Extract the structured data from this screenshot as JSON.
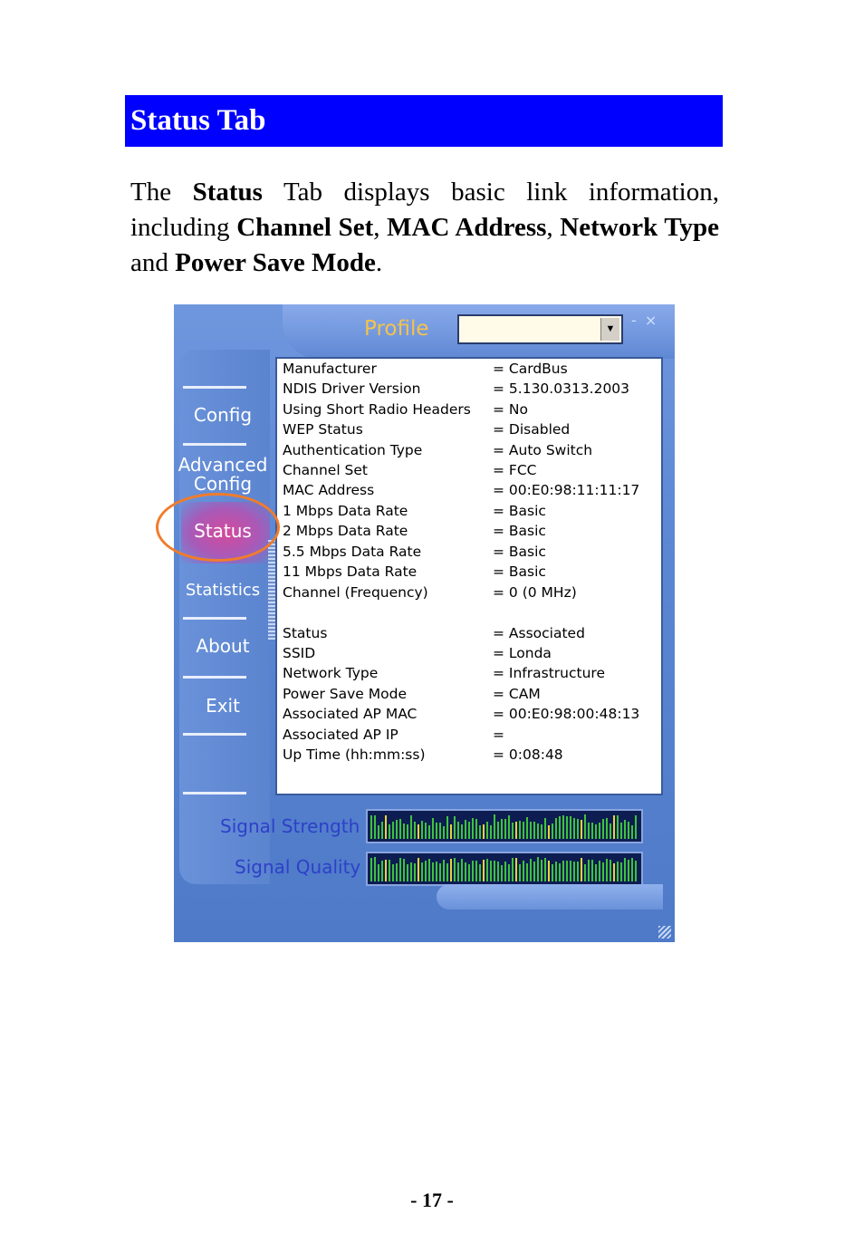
{
  "heading": "Status Tab",
  "intro": {
    "t1": "The ",
    "b1": "Status",
    "t2": " Tab displays basic link information, including ",
    "b2": "Channel Set",
    "t3": ", ",
    "b3": "MAC Address",
    "t4": ", ",
    "b4": "Network Type",
    "t5": " and ",
    "b5": "Power Save Mode",
    "t6": "."
  },
  "app": {
    "profile_label": "Profile",
    "profile_value": "",
    "window_buttons": "- ×",
    "nav": {
      "config": "Config",
      "advanced_1": "Advanced",
      "advanced_2": "Config",
      "status": "Status",
      "statistics": "Statistics",
      "about": "About",
      "exit": "Exit"
    },
    "rows": [
      {
        "label": "Manufacturer",
        "value": "=  CardBus"
      },
      {
        "label": "NDIS Driver Version",
        "value": "=  5.130.0313.2003"
      },
      {
        "label": "Using Short Radio Headers",
        "value": "=  No"
      },
      {
        "label": "WEP Status",
        "value": "=  Disabled"
      },
      {
        "label": "Authentication Type",
        "value": "=  Auto Switch"
      },
      {
        "label": "Channel Set",
        "value": "=  FCC"
      },
      {
        "label": "MAC Address",
        "value": "=  00:E0:98:11:11:17"
      },
      {
        "label": "1 Mbps Data Rate",
        "value": "=  Basic"
      },
      {
        "label": "2 Mbps Data Rate",
        "value": "=  Basic"
      },
      {
        "label": "5.5 Mbps Data Rate",
        "value": "=  Basic"
      },
      {
        "label": "11 Mbps Data Rate",
        "value": "=  Basic"
      },
      {
        "label": "Channel (Frequency)",
        "value": "=  0 (0 MHz)"
      },
      {
        "label": "Status",
        "value": "=  Associated"
      },
      {
        "label": "SSID",
        "value": "=  Londa"
      },
      {
        "label": "Network Type",
        "value": "=  Infrastructure"
      },
      {
        "label": "Power Save Mode",
        "value": "=  CAM"
      },
      {
        "label": "Associated AP MAC",
        "value": "=  00:E0:98:00:48:13"
      },
      {
        "label": "Associated AP IP",
        "value": "="
      },
      {
        "label": "Up Time (hh:mm:ss)",
        "value": "=  0:08:48"
      }
    ],
    "signal_strength_label": "Signal Strength",
    "signal_quality_label": "Signal Quality",
    "colors": {
      "heading_bg": "#0000ff",
      "highlight_ring": "#f07c2c",
      "profile_label": "#f4c24c",
      "signal_label": "#2e40c8",
      "meter_green": "#3fc23c",
      "meter_yellow": "#e8d23a"
    }
  },
  "page_number": "- 17 -"
}
